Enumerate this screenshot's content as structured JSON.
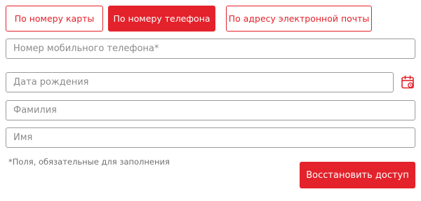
{
  "tabs": {
    "card": "По номеру карты",
    "phone": "По номеру телефона",
    "email": "По адресу электронной почты",
    "active": "phone"
  },
  "fields": {
    "phone_placeholder": "Номер мобильного телефона*",
    "birth_placeholder": "Дата рождения",
    "last_name_placeholder": "Фамилия",
    "first_name_placeholder": "Имя"
  },
  "icons": {
    "calendar": "calendar-icon"
  },
  "note": "*Поля, обязательные для заполнения",
  "submit_label": "Восстановить доступ",
  "colors": {
    "accent": "#e3222b",
    "border": "#9b9b9b",
    "placeholder": "#8a8a8a"
  }
}
